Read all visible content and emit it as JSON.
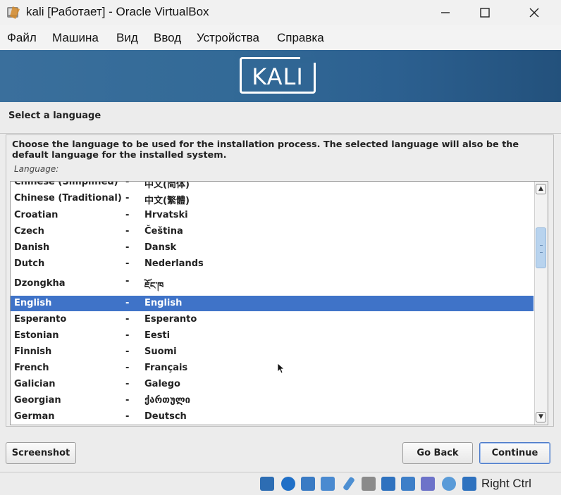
{
  "window": {
    "title": "kali [Работает] - Oracle VirtualBox",
    "app_icon": "virtualbox-icon",
    "controls": [
      "minimize-icon",
      "maximize-icon",
      "close-icon"
    ]
  },
  "menu": [
    "Файл",
    "Машина",
    "Вид",
    "Ввод",
    "Устройства",
    "Справка"
  ],
  "banner": {
    "logo_text": "KALI",
    "gradient": [
      "#3a6f9c",
      "#23517c"
    ]
  },
  "installer": {
    "step_title": "Select a language",
    "description": "Choose the language to be used for the installation process. The selected language will also be the default language for the installed system.",
    "list_label": "Language:",
    "separator": "-",
    "languages": [
      {
        "name": "Chinese (Simplified)",
        "native": "中文(简体)"
      },
      {
        "name": "Chinese (Traditional)",
        "native": "中文(繁體)"
      },
      {
        "name": "Croatian",
        "native": "Hrvatski"
      },
      {
        "name": "Czech",
        "native": "Čeština"
      },
      {
        "name": "Danish",
        "native": "Dansk"
      },
      {
        "name": "Dutch",
        "native": "Nederlands"
      },
      {
        "name": "Dzongkha",
        "native": "ཇོང་ཁ"
      },
      {
        "name": "English",
        "native": "English",
        "selected": true
      },
      {
        "name": "Esperanto",
        "native": "Esperanto"
      },
      {
        "name": "Estonian",
        "native": "Eesti"
      },
      {
        "name": "Finnish",
        "native": "Suomi"
      },
      {
        "name": "French",
        "native": "Français"
      },
      {
        "name": "Galician",
        "native": "Galego"
      },
      {
        "name": "Georgian",
        "native": "ქართული"
      },
      {
        "name": "German",
        "native": "Deutsch"
      }
    ],
    "selection_color": "#3f73c8",
    "buttons": {
      "screenshot": "Screenshot",
      "go_back": "Go Back",
      "continue": "Continue"
    }
  },
  "statusbar": {
    "icons": [
      "hard-disk-icon",
      "optical-drive-icon",
      "audio-icon",
      "network-icon",
      "usb-icon",
      "shared-folder-icon",
      "display-icon",
      "recording-icon",
      "virtualization-icon",
      "mouse-integration-icon",
      "keyboard-capture-icon"
    ],
    "host_key": "Right Ctrl"
  }
}
